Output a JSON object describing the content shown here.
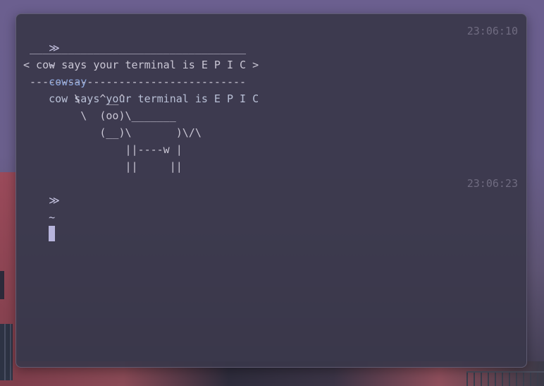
{
  "prompt": {
    "symbol": "≫",
    "cwd": "~"
  },
  "command": {
    "name": "cowsay",
    "args": "cow says your terminal is E P I C",
    "timestamp": "23:06:10"
  },
  "output_lines": [
    " __________________________________",
    "< cow says your terminal is E P I C >",
    " ----------------------------------",
    "        \\   ^__^",
    "         \\  (oo)\\_______",
    "            (__)\\       )\\/\\",
    "                ||----w |",
    "                ||     ||"
  ],
  "current_prompt": {
    "timestamp": "23:06:23"
  }
}
